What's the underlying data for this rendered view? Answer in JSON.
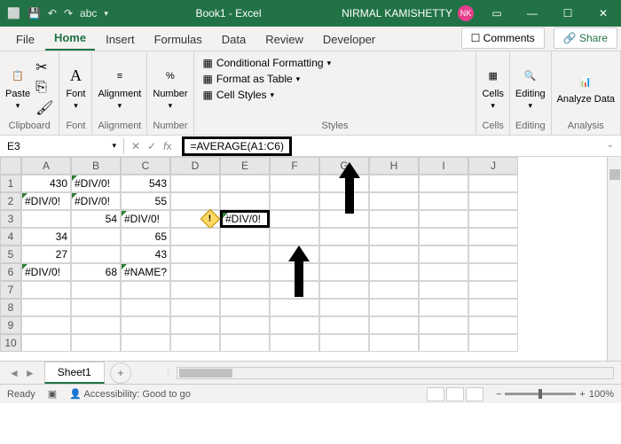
{
  "title": {
    "doc": "Book1 - Excel",
    "user": "NIRMAL KAMISHETTY",
    "initials": "NK"
  },
  "qat": {
    "autosave_label": "abc",
    "undo": "↶",
    "redo": "↷"
  },
  "tabs": {
    "file": "File",
    "home": "Home",
    "insert": "Insert",
    "formulas": "Formulas",
    "data": "Data",
    "review": "Review",
    "developer": "Developer",
    "comments": "☐ Comments",
    "share": "🔗 Share"
  },
  "ribbon": {
    "clipboard": {
      "paste": "Paste",
      "label": "Clipboard"
    },
    "font": {
      "btn": "Font",
      "label": "Font"
    },
    "alignment": {
      "btn": "Alignment",
      "label": "Alignment"
    },
    "number": {
      "btn": "Number",
      "label": "Number"
    },
    "styles": {
      "cond": "Conditional Formatting",
      "table": "Format as Table",
      "cell": "Cell Styles",
      "label": "Styles"
    },
    "cells": {
      "btn": "Cells",
      "label": "Cells"
    },
    "editing": {
      "btn": "Editing",
      "label": "Editing"
    },
    "analysis": {
      "btn": "Analyze Data",
      "label": "Analysis"
    }
  },
  "namebox": "E3",
  "formula": "=AVERAGE(A1:C6)",
  "cols": [
    "A",
    "B",
    "C",
    "D",
    "E",
    "F",
    "G",
    "H",
    "I",
    "J"
  ],
  "rows": [
    "1",
    "2",
    "3",
    "4",
    "5",
    "6",
    "7",
    "8",
    "9",
    "10"
  ],
  "cells": {
    "A1": "430",
    "B1": "#DIV/0!",
    "C1": "543",
    "A2": "#DIV/0!",
    "B2": "#DIV/0!",
    "C2": "55",
    "B3": "54",
    "C3": "#DIV/0!",
    "E3": "#DIV/0!",
    "A4": "34",
    "C4": "65",
    "A5": "27",
    "C5": "43",
    "A6": "#DIV/0!",
    "B6": "68",
    "C6": "#NAME?"
  },
  "sheet": {
    "name": "Sheet1",
    "add": "+"
  },
  "status": {
    "ready": "Ready",
    "acc": "Accessibility: Good to go",
    "zoom": "100%"
  }
}
